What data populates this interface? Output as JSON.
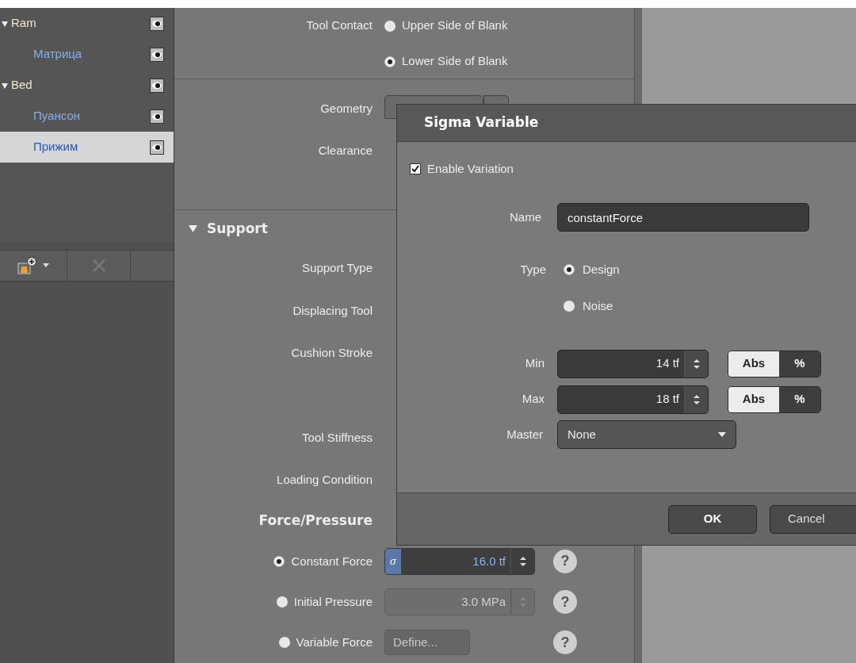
{
  "tree": {
    "items": [
      {
        "label": "Ram",
        "expanded": true,
        "selected": false,
        "children": [
          {
            "label": "Матрица",
            "selected": false
          }
        ]
      },
      {
        "label": "Bed",
        "expanded": true,
        "selected": false,
        "children": [
          {
            "label": "Пуансон",
            "selected": false
          },
          {
            "label": "Прижим",
            "selected": true
          }
        ]
      }
    ],
    "toolbar": {
      "delete_disabled": true
    }
  },
  "properties": {
    "tool_contact": {
      "label": "Tool Contact",
      "options": [
        {
          "label": "Upper Side of Blank",
          "selected": false
        },
        {
          "label": "Lower Side of Blank",
          "selected": true
        }
      ]
    },
    "geometry": {
      "label": "Geometry"
    },
    "clearance": {
      "label": "Clearance"
    },
    "support": {
      "title": "Support",
      "expanded": true,
      "rows": [
        {
          "label": "Support Type"
        },
        {
          "label": "Displacing Tool"
        },
        {
          "label": "Cushion Stroke"
        },
        {
          "label": "Tool Stiffness"
        },
        {
          "label": "Loading Condition"
        }
      ]
    },
    "force_pressure": {
      "title": "Force/Pressure",
      "options": [
        {
          "kind": "spinner",
          "label": "Constant Force",
          "selected": true,
          "disabled": false,
          "badge": "σ",
          "value": "16.0 tf",
          "help": "?"
        },
        {
          "kind": "spinner",
          "label": "Initial Pressure",
          "selected": false,
          "disabled": true,
          "value": "3.0 MPa",
          "help": "?"
        },
        {
          "kind": "button",
          "label": "Variable Force",
          "selected": false,
          "disabled": true,
          "value": "Define...",
          "help": "?"
        }
      ]
    }
  },
  "dialog": {
    "title": "Sigma Variable",
    "enable": {
      "label": "Enable Variation",
      "checked": true
    },
    "name": {
      "label": "Name",
      "value": "constantForce"
    },
    "type": {
      "label": "Type",
      "options": [
        {
          "label": "Design",
          "selected": true
        },
        {
          "label": "Noise",
          "selected": false
        }
      ]
    },
    "ranges": [
      {
        "label": "Min",
        "value": "14 tf",
        "units": [
          {
            "label": "Abs",
            "selected": true
          },
          {
            "label": "%",
            "selected": false
          }
        ]
      },
      {
        "label": "Max",
        "value": "18 tf",
        "units": [
          {
            "label": "Abs",
            "selected": true
          },
          {
            "label": "%",
            "selected": false
          }
        ]
      }
    ],
    "master": {
      "label": "Master",
      "value": "None"
    },
    "buttons": [
      {
        "label": "OK",
        "default": true
      },
      {
        "label": "Cancel",
        "default": false
      }
    ]
  }
}
